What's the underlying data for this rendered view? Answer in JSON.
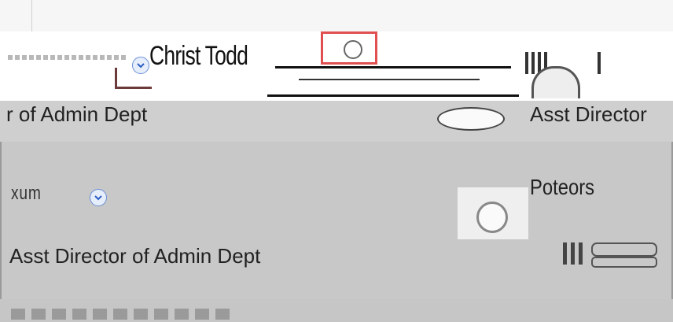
{
  "header": {
    "person_name": "Christ Todd",
    "expand_control_label": "",
    "info_control_label": ""
  },
  "rows": [
    {
      "left_title": "r of Admin Dept",
      "right_title": "Asst Director"
    },
    {
      "left_name": "xum",
      "right_name": "Poteors"
    },
    {
      "left_title": "Asst Director of Admin Dept",
      "right_title": ""
    }
  ],
  "colors": {
    "highlight_box": "#e05050",
    "chevron_accent": "#6a8fd6"
  },
  "icons": {
    "chevron": "chevron-down-icon",
    "info": "info-icon",
    "avatar_placeholder": "avatar-icon"
  }
}
